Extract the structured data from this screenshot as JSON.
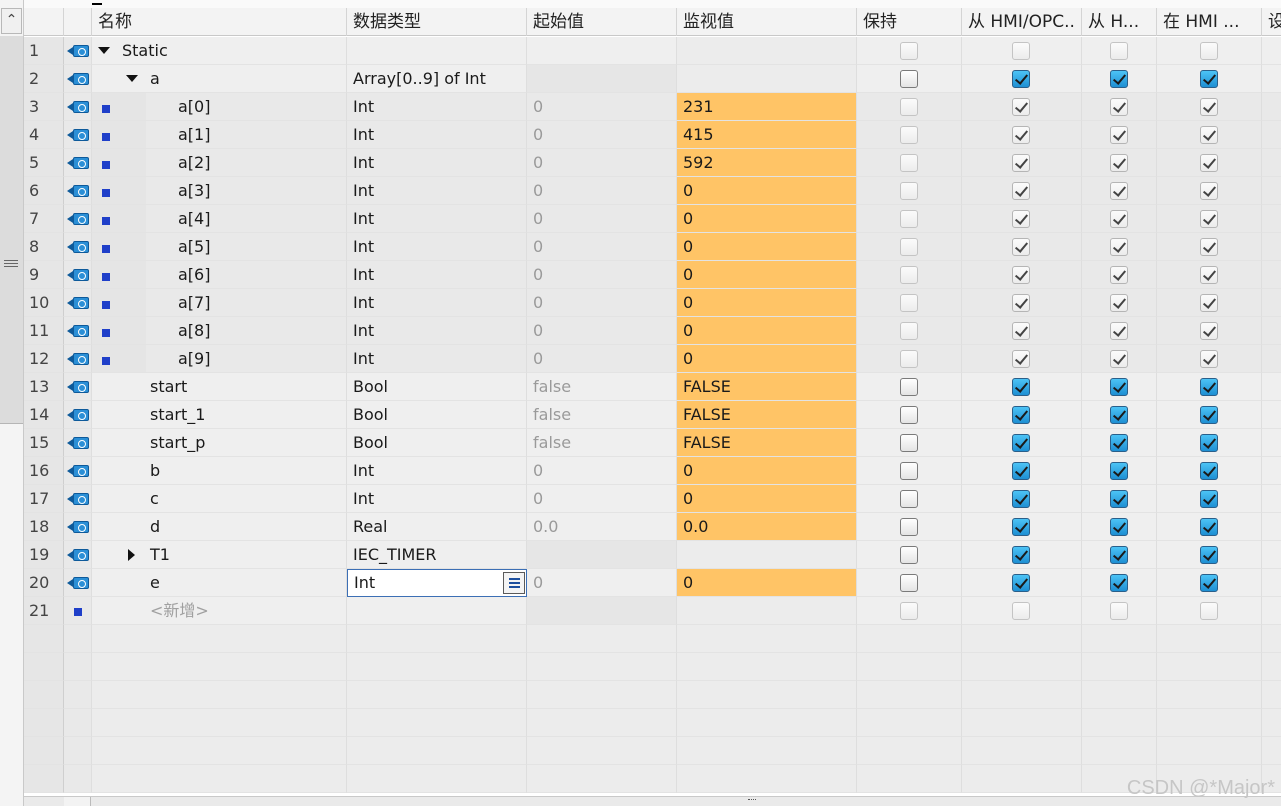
{
  "columns": {
    "name": "名称",
    "datatype": "数据类型",
    "start_value": "起始值",
    "monitor_value": "监视值",
    "retain": "保持",
    "from_hmi_opc": "从 HMI/OPC..",
    "from_h": "从 H...",
    "in_hmi": "在 HMI ...",
    "set": "设"
  },
  "rows": [
    {
      "num": "1",
      "name": "Static",
      "type": "",
      "start": "",
      "monitor": ""
    },
    {
      "num": "2",
      "name": "a",
      "type": "Array[0..9] of Int",
      "start": "",
      "monitor": ""
    },
    {
      "num": "3",
      "name": "a[0]",
      "type": "Int",
      "start": "0",
      "monitor": "231"
    },
    {
      "num": "4",
      "name": "a[1]",
      "type": "Int",
      "start": "0",
      "monitor": "415"
    },
    {
      "num": "5",
      "name": "a[2]",
      "type": "Int",
      "start": "0",
      "monitor": "592"
    },
    {
      "num": "6",
      "name": "a[3]",
      "type": "Int",
      "start": "0",
      "monitor": "0"
    },
    {
      "num": "7",
      "name": "a[4]",
      "type": "Int",
      "start": "0",
      "monitor": "0"
    },
    {
      "num": "8",
      "name": "a[5]",
      "type": "Int",
      "start": "0",
      "monitor": "0"
    },
    {
      "num": "9",
      "name": "a[6]",
      "type": "Int",
      "start": "0",
      "monitor": "0"
    },
    {
      "num": "10",
      "name": "a[7]",
      "type": "Int",
      "start": "0",
      "monitor": "0"
    },
    {
      "num": "11",
      "name": "a[8]",
      "type": "Int",
      "start": "0",
      "monitor": "0"
    },
    {
      "num": "12",
      "name": "a[9]",
      "type": "Int",
      "start": "0",
      "monitor": "0"
    },
    {
      "num": "13",
      "name": "start",
      "type": "Bool",
      "start": "false",
      "monitor": "FALSE"
    },
    {
      "num": "14",
      "name": "start_1",
      "type": "Bool",
      "start": "false",
      "monitor": "FALSE"
    },
    {
      "num": "15",
      "name": "start_p",
      "type": "Bool",
      "start": "false",
      "monitor": "FALSE"
    },
    {
      "num": "16",
      "name": "b",
      "type": "Int",
      "start": "0",
      "monitor": "0"
    },
    {
      "num": "17",
      "name": "c",
      "type": "Int",
      "start": "0",
      "monitor": "0"
    },
    {
      "num": "18",
      "name": "d",
      "type": "Real",
      "start": "0.0",
      "monitor": "0.0"
    },
    {
      "num": "19",
      "name": "T1",
      "type": "IEC_TIMER",
      "start": "",
      "monitor": ""
    },
    {
      "num": "20",
      "name": "e",
      "type": "Int",
      "start": "0",
      "monitor": "0"
    },
    {
      "num": "21",
      "name": "<新增>",
      "type": "",
      "start": "",
      "monitor": ""
    }
  ],
  "watermark": "CSDN @*Major*",
  "colors": {
    "monitor_highlight": "#ffc466",
    "checkbox_on": "#1e8fd3",
    "element_marker": "#1f3fc9"
  },
  "icons": {
    "interface": "interface-icon",
    "scroll_up": "chevron-up-icon",
    "expand": "expand-triangle-icon",
    "collapse": "collapse-triangle-icon",
    "list_button": "list-icon"
  }
}
